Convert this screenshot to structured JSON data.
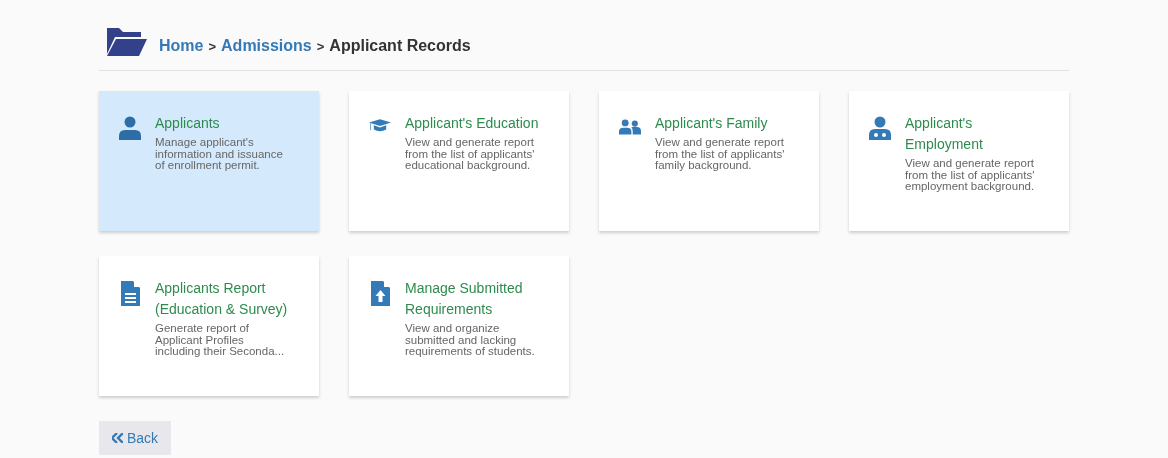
{
  "breadcrumb": {
    "items": [
      {
        "label": "Home",
        "kind": "link"
      },
      {
        "label": "Admissions",
        "kind": "link"
      },
      {
        "label": "Applicant Records",
        "kind": "current"
      }
    ],
    "separator": ">"
  },
  "cards": [
    {
      "kind": "user",
      "title": "Applicants",
      "description": "Manage applicant's information and issuance of enrollment permit.",
      "selected": true
    },
    {
      "kind": "graduation",
      "title": "Applicant's Education",
      "description": "View and generate report from the list of applicants' educational background.",
      "selected": false
    },
    {
      "kind": "users",
      "title": "Applicant's Family",
      "description": "View and generate report from the list of applicants' family background.",
      "selected": false
    },
    {
      "kind": "doctor",
      "title": "Applicant's Employment",
      "description": "View and generate report from the list of applicants' employment background.",
      "selected": false
    },
    {
      "kind": "document",
      "title": "Applicants Report (Education & Survey)",
      "description": "Generate report of Applicant Profiles including their Seconda...",
      "selected": false
    },
    {
      "kind": "upload",
      "title": "Manage Submitted Requirements",
      "description": "View and organize submitted and lacking requirements of students.",
      "selected": false
    }
  ],
  "back_button": {
    "label": "Back"
  }
}
